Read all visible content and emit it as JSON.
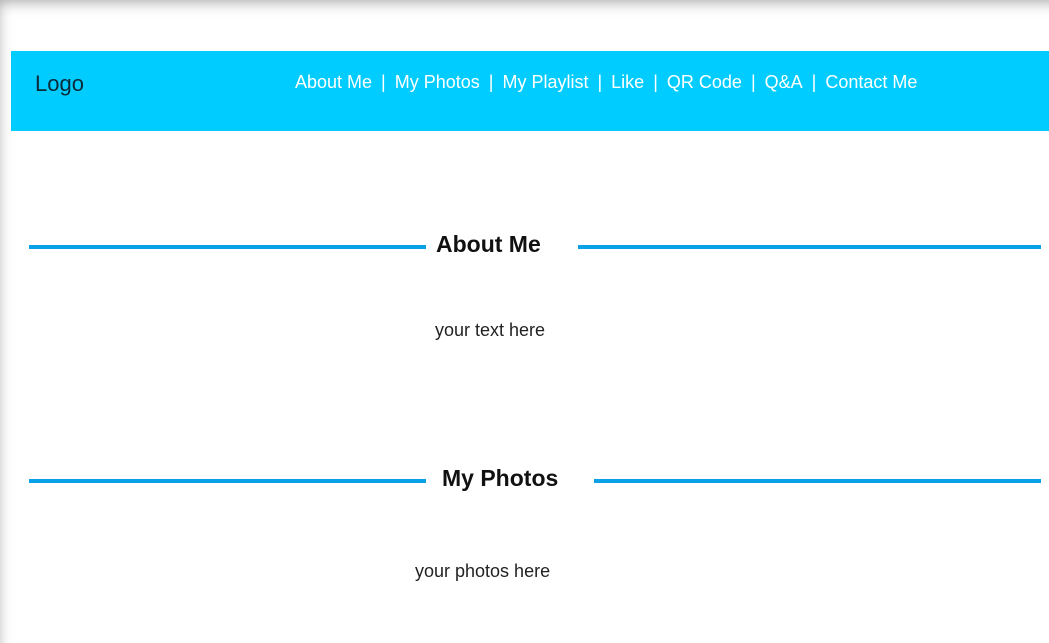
{
  "header": {
    "logo": "Logo",
    "nav": [
      {
        "label": "About Me"
      },
      {
        "label": "My Photos"
      },
      {
        "label": "My Playlist"
      },
      {
        "label": "Like"
      },
      {
        "label": "QR Code"
      },
      {
        "label": "Q&A"
      },
      {
        "label": "Contact Me"
      }
    ],
    "separator": "|"
  },
  "sections": [
    {
      "title": "About Me",
      "text": "your text here"
    },
    {
      "title": "My Photos",
      "text": "your photos here"
    }
  ],
  "colors": {
    "navbar_background": "#00ccff",
    "section_rule": "#0aa0e8",
    "page_background": "#ffffff"
  }
}
